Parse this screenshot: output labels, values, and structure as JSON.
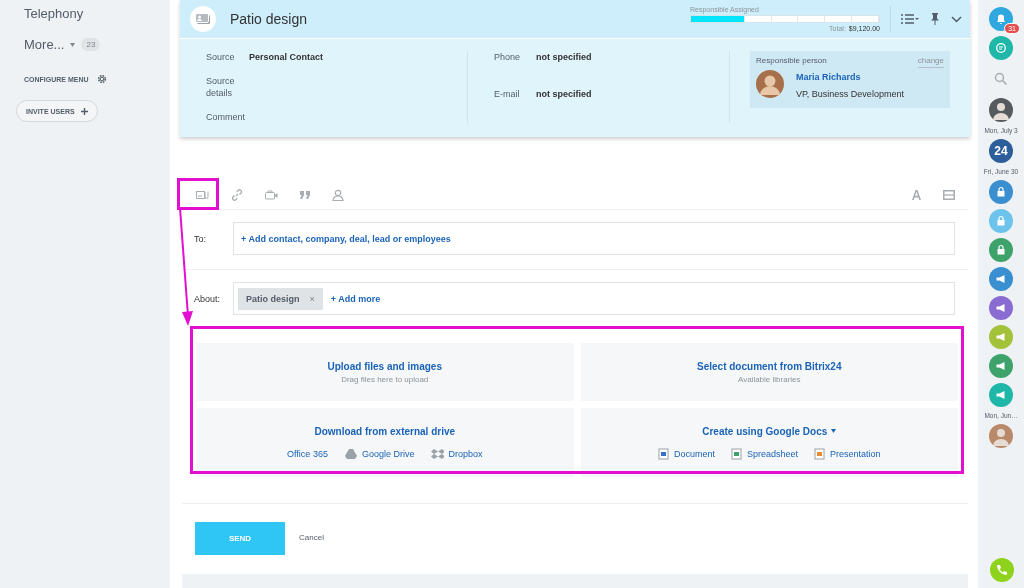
{
  "left_menu": {
    "items": [
      {
        "label": "Telephony"
      }
    ],
    "more": {
      "label": "More...",
      "count": "23"
    },
    "configure": "CONFIGURE MENU",
    "invite": "INVITE USERS"
  },
  "deal": {
    "title": "Patio design",
    "stage": {
      "label": "Responsible Assigned",
      "level": 0.28,
      "total_label": "Total:",
      "total": "$9,120.00"
    },
    "fields_left": [
      {
        "label": "Source",
        "value": "Personal Contact"
      },
      {
        "label": "Source details"
      },
      {
        "label": "Comment"
      }
    ],
    "fields_mid": [
      {
        "label": "Phone",
        "value": "not specified"
      },
      {
        "label": "E-mail",
        "value": "not specified"
      }
    ],
    "responsible": {
      "heading": "Responsible person",
      "change": "change",
      "name": "Maria Richards",
      "position": "VP, Business Development"
    }
  },
  "editor": {
    "to": {
      "label": "To:",
      "placeholder": "+ Add contact, company, deal, lead or employees"
    },
    "about": {
      "label": "About:",
      "tag": "Patio design",
      "tag_remove": "×",
      "add": "+ Add more"
    },
    "upload": {
      "title": "Upload files and images",
      "hint": "Drag files here to upload"
    },
    "bitrix": {
      "title": "Select document from Bitrix24",
      "hint": "Available libraries"
    },
    "external": {
      "title": "Download from external drive",
      "links": [
        {
          "kind": "office",
          "label": "Office 365"
        },
        {
          "kind": "gdrive",
          "label": "Google Drive"
        },
        {
          "kind": "dropbox",
          "label": "Dropbox"
        }
      ]
    },
    "google": {
      "title": "Create using Google Docs",
      "links": [
        {
          "kind": "doc",
          "label": "Document"
        },
        {
          "kind": "sheet",
          "label": "Spreadsheet"
        },
        {
          "kind": "slides",
          "label": "Presentation"
        }
      ]
    },
    "send": "SEND",
    "cancel": "Cancel"
  },
  "rail": [
    {
      "kind": "bell",
      "color": "#2fa8e0",
      "badge": "31"
    },
    {
      "kind": "chat",
      "color": "#1fb8a8"
    },
    {
      "kind": "search"
    },
    {
      "kind": "avatar",
      "color": "#555a5e"
    },
    {
      "kind": "date",
      "label": "Mon, July 3"
    },
    {
      "kind": "calendar",
      "color": "#2d5e9c",
      "label": "24"
    },
    {
      "kind": "date",
      "label": "Fri, June 30"
    },
    {
      "kind": "lock",
      "color": "#3a8fd0"
    },
    {
      "kind": "lock",
      "color": "#6cc4ec"
    },
    {
      "kind": "lock",
      "color": "#3ea36b"
    },
    {
      "kind": "megaphone",
      "color": "#3a8fd0"
    },
    {
      "kind": "megaphone",
      "color": "#8a6bd1"
    },
    {
      "kind": "megaphone",
      "color": "#a3c23a"
    },
    {
      "kind": "megaphone",
      "color": "#3ea36b"
    },
    {
      "kind": "megaphone",
      "color": "#1fb8a8"
    },
    {
      "kind": "date",
      "label": "Mon, Jun…"
    },
    {
      "kind": "avatar",
      "color": "#b98a6a"
    }
  ],
  "phone": {
    "color": "#8fd21c"
  }
}
